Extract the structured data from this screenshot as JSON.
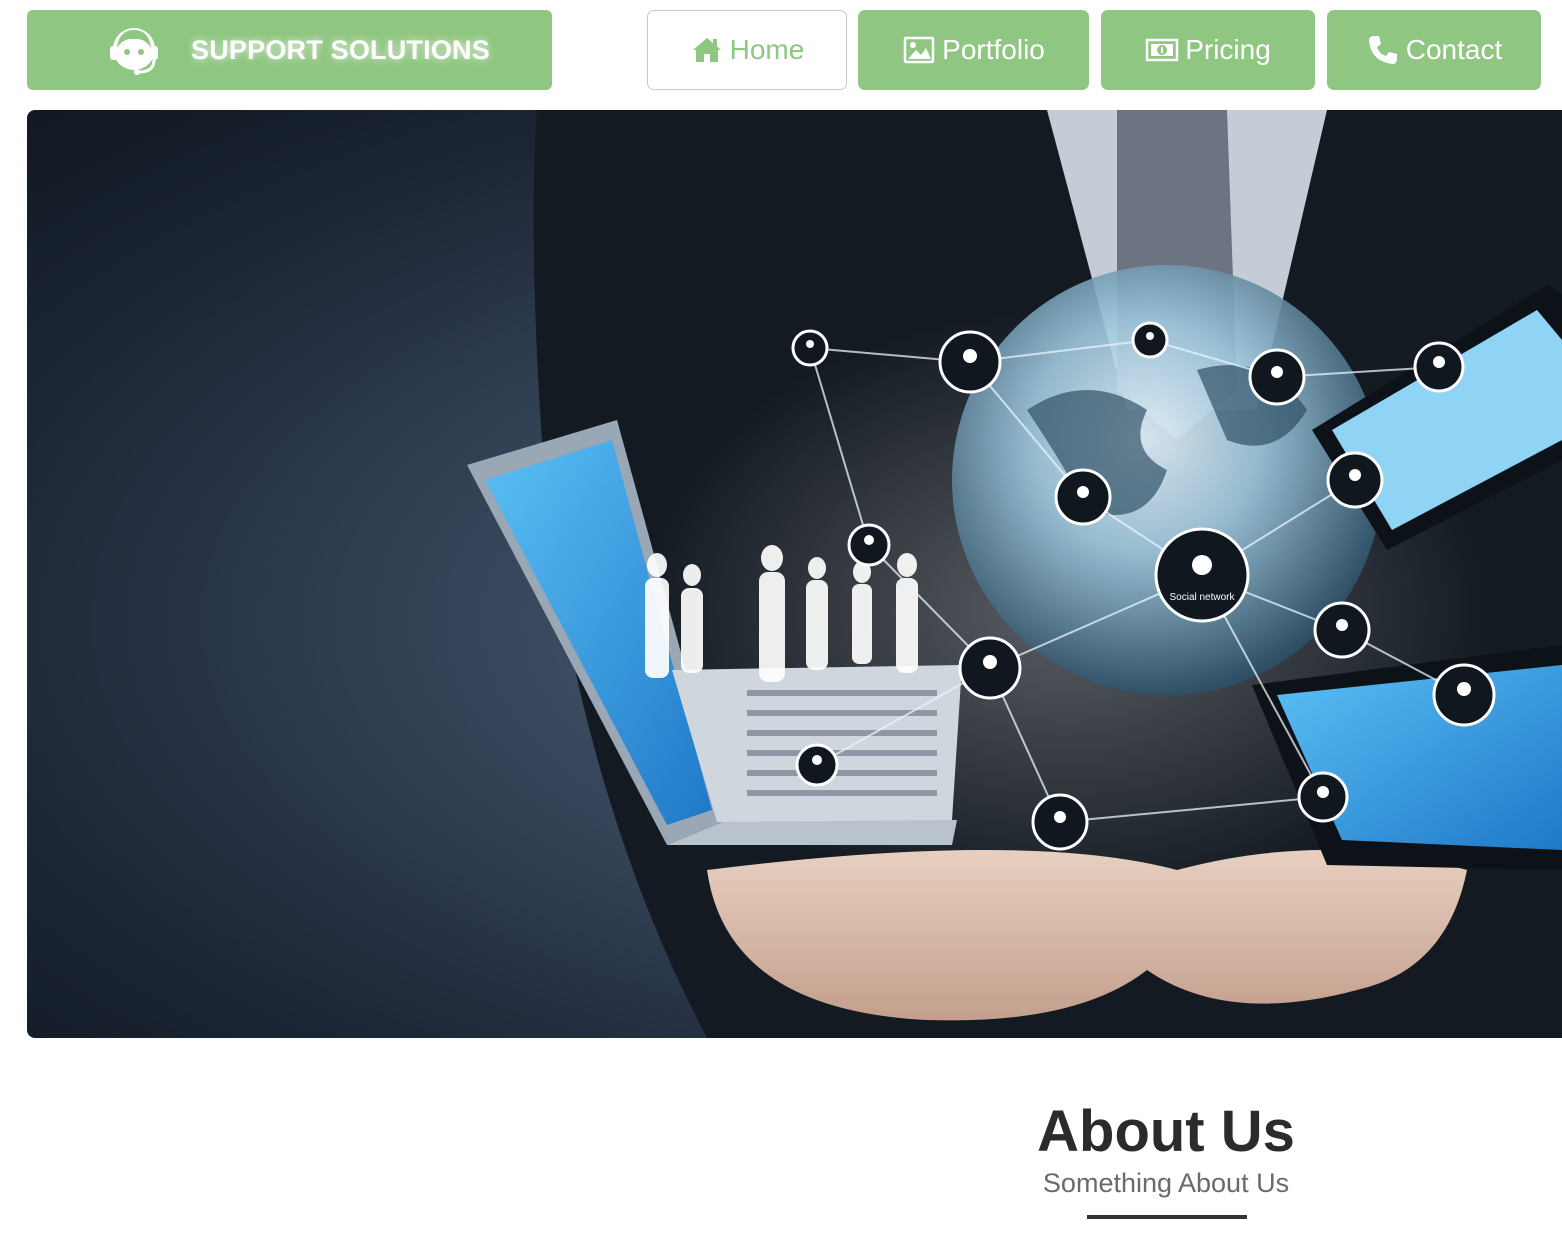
{
  "header": {
    "brand_name": "SUPPORT SOLUTIONS",
    "brand_icon": "support-agent-icon",
    "brand_color": "#8fc681"
  },
  "nav": {
    "items": [
      {
        "label": "Home",
        "icon": "home-icon",
        "active": true
      },
      {
        "label": "Portfolio",
        "icon": "image-icon",
        "active": false
      },
      {
        "label": "Pricing",
        "icon": "money-icon",
        "active": false
      },
      {
        "label": "Contact",
        "icon": "phone-icon",
        "active": false
      }
    ]
  },
  "hero": {
    "image_label": "Social network"
  },
  "about": {
    "title": "About Us",
    "subtitle": "Something About Us"
  }
}
